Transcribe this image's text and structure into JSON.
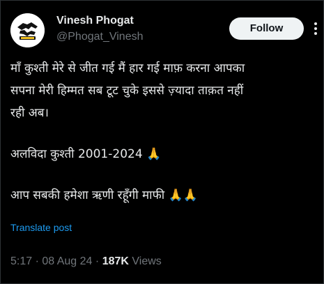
{
  "author": {
    "display_name": "Vinesh Phogat",
    "handle": "@Phogat_Vinesh",
    "avatar_icon": "wrestling-logo-avatar"
  },
  "actions": {
    "follow_label": "Follow",
    "more_icon": "more-vertical-icon"
  },
  "tweet": {
    "lines": [
      "माँ कुश्ती मेरे से जीत गई मैं हार गई माफ़ करना आपका",
      "सपना मेरी हिम्मत सब टूट चुके इससे ज़्यादा ताक़त नहीं",
      "रही अब।",
      "अलविदा कुश्ती 2001-2024",
      "आप सबकी हमेशा ऋणी रहूँगी माफी"
    ],
    "emoji_1": "🙏",
    "emoji_2": "🙏🙏"
  },
  "translate_label": "Translate post",
  "meta": {
    "time": "5:17",
    "separator": "·",
    "date": "08 Aug 24",
    "views_count": "187K",
    "views_label": "Views"
  },
  "colors": {
    "background": "#000000",
    "text_primary": "#e7e9ea",
    "text_secondary": "#71767b",
    "link_blue": "#1d9bf0",
    "button_bg": "#eff3f4"
  }
}
